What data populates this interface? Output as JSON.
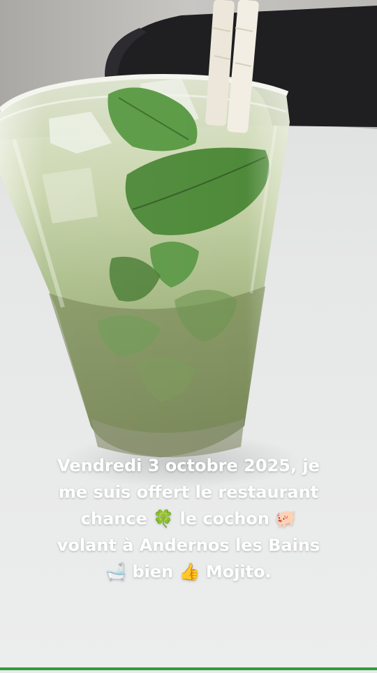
{
  "photo": {
    "subject": "mojito-glass",
    "colors": {
      "table": "#e9eaea",
      "wall": "#bdbdbb",
      "chair": "#1f1f22",
      "drink": "#b8c79a",
      "mint": "#4f8a3a",
      "straw": "#ece7da"
    }
  },
  "caption": {
    "line1": "Vendredi 3 octobre 2025, je",
    "line2": "me suis offert le restaurant",
    "line3": "chance 🍀 le cochon 🐖",
    "line4": "volant à Andernos les Bains",
    "line5": "🛁 bien 👍 Mojito.",
    "color": "#ffffff"
  },
  "bottom_bar": {
    "color": "#2e9e3a"
  }
}
